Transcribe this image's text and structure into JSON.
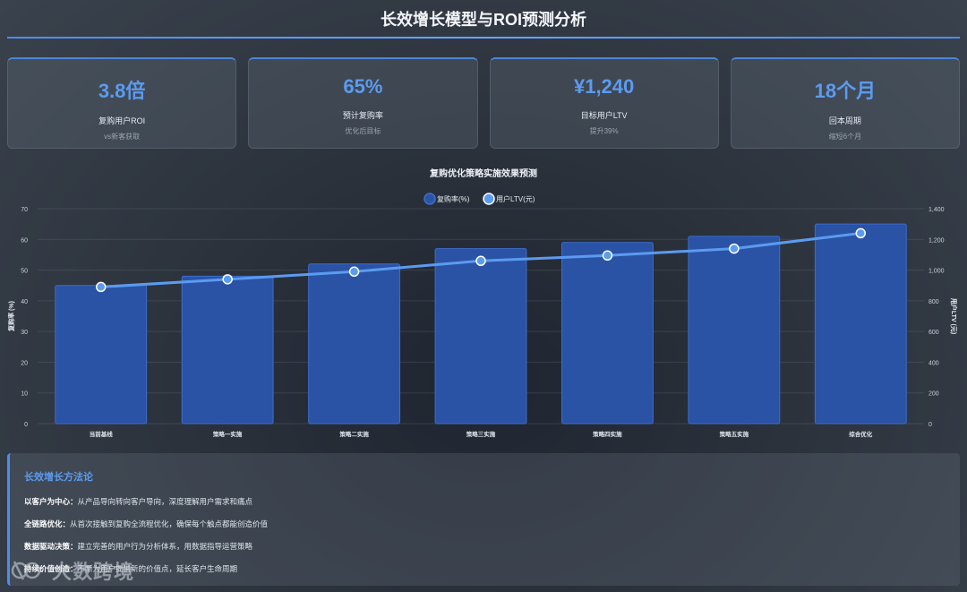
{
  "page": {
    "title": "长效增长模型与ROI预测分析"
  },
  "kpis": [
    {
      "value": "3.8倍",
      "label": "复购用户ROI",
      "sub": "vs新客获取"
    },
    {
      "value": "65%",
      "label": "预计复购率",
      "sub": "优化后目标"
    },
    {
      "value": "¥1,240",
      "label": "目标用户LTV",
      "sub": "提升39%"
    },
    {
      "value": "18个月",
      "label": "回本周期",
      "sub": "缩短6个月"
    }
  ],
  "colors": {
    "accent": "#4a8ef0",
    "bar": "#2b54a8",
    "line": "#5b9bf0"
  },
  "chart_data": {
    "type": "bar",
    "title": "复购优化策略实施效果预测",
    "categories": [
      "当前基线",
      "策略一实施",
      "策略二实施",
      "策略三实施",
      "策略四实施",
      "策略五实施",
      "综合优化"
    ],
    "series": [
      {
        "name": "复购率(%)",
        "type": "bar",
        "axis": "left",
        "values": [
          45,
          48,
          52,
          57,
          59,
          61,
          65
        ]
      },
      {
        "name": "用户LTV(元)",
        "type": "line",
        "axis": "right",
        "values": [
          890,
          940,
          990,
          1060,
          1095,
          1140,
          1240
        ]
      }
    ],
    "ylabel": "复购率 (%)",
    "y2label": "用户LTV (元)",
    "ylim": [
      0,
      70
    ],
    "y2lim": [
      0,
      1400
    ],
    "yticks": [
      "0",
      "10",
      "20",
      "30",
      "40",
      "50",
      "60",
      "70"
    ],
    "y2ticks": [
      "0",
      "200",
      "400",
      "600",
      "800",
      "1,000",
      "1,200",
      "1,400"
    ],
    "legend": "top-center",
    "grid": true
  },
  "methodology": {
    "title": "长效增长方法论",
    "items": [
      {
        "key": "以客户为中心：",
        "text": "从产品导向转向客户导向，深度理解用户需求和痛点"
      },
      {
        "key": "全链路优化：",
        "text": "从首次接触到复购全流程优化，确保每个触点都能创造价值"
      },
      {
        "key": "数据驱动决策：",
        "text": "建立完善的用户行为分析体系，用数据指导运营策略"
      },
      {
        "key": "持续价值创造：",
        "text": "不断为用户提供新的价值点，延长客户生命周期"
      }
    ]
  },
  "watermark": {
    "text": "大数跨境"
  }
}
